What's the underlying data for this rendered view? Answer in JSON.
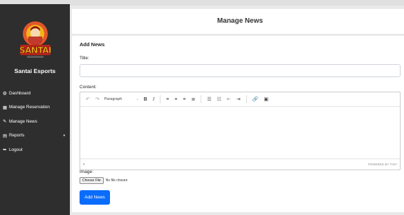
{
  "brand": {
    "logo_text": "SANTAI",
    "name": "Santai Esports"
  },
  "nav": [
    {
      "icon": "dashboard-icon",
      "glyph": "◍",
      "label": "Dashboard"
    },
    {
      "icon": "calendar-icon",
      "glyph": "▦",
      "label": "Manage Reservation"
    },
    {
      "icon": "edit-icon",
      "glyph": "✎",
      "label": "Manage News"
    },
    {
      "icon": "document-icon",
      "glyph": "▤",
      "label": "Reports",
      "caret": "▾"
    },
    {
      "icon": "logout-icon",
      "glyph": "➥",
      "label": "Logout"
    }
  ],
  "header": {
    "title": "Manage News"
  },
  "form": {
    "section_title": "Add News",
    "title_label": "Title:",
    "title_value": "",
    "content_label": "Content:",
    "editor": {
      "undo": "↶",
      "redo": "↷",
      "block_format": "Paragraph",
      "chevron": "⌄",
      "bold": "B",
      "italic": "I",
      "align_left": "≡",
      "align_center": "≡",
      "align_right": "≡",
      "align_justify": "≣",
      "bullet_list": "☰",
      "numbered_list": "☷",
      "outdent": "⇤",
      "indent": "⇥",
      "link": "🔗",
      "image": "▣",
      "path": "P",
      "powered_by": "POWERED BY TINY"
    },
    "image_label": "Image:",
    "file_button": "Choose File",
    "file_status": "No file chosen",
    "submit_label": "Add News"
  },
  "colors": {
    "sidebar_bg": "#2e2e2e",
    "page_bg": "#e9e9e9",
    "accent": "#0a6cfb",
    "logo_orange": "#e2572a",
    "logo_gold": "#f3b41b"
  }
}
